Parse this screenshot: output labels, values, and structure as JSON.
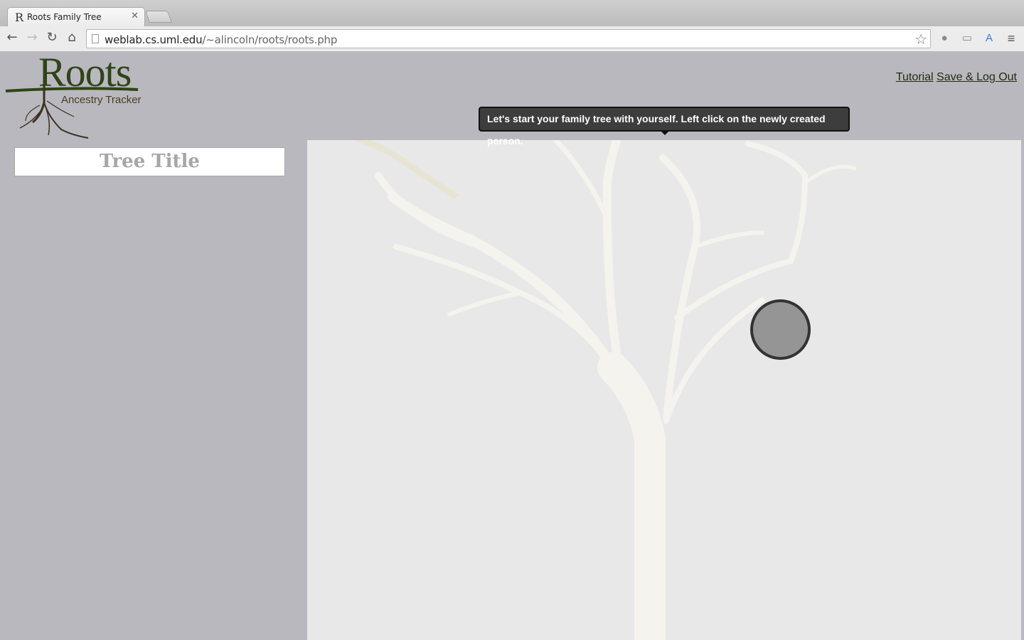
{
  "browser": {
    "tab_title": "Roots Family Tree",
    "tab_favicon": "R",
    "url_host": "weblab.cs.uml.edu",
    "url_path": "/~alincoln/roots/roots.php"
  },
  "header": {
    "logo_title": "Roots",
    "logo_subtitle": "Ancestry Tracker",
    "links": {
      "tutorial": "Tutorial",
      "save_logout": "Save & Log Out"
    }
  },
  "sidebar": {
    "tree_title": "Tree Title"
  },
  "tutorial": {
    "tooltip_text": "Let's start your family tree with yourself. Left click on the newly created person."
  },
  "colors": {
    "page_bg": "#b9b8be",
    "canvas_bg": "#e8e8e8",
    "logo_green": "#2f4418",
    "node_fill": "#959595"
  },
  "icons": {
    "back": "back-arrow-icon",
    "forward": "forward-arrow-icon",
    "reload": "reload-icon",
    "home": "home-icon",
    "star": "star-icon",
    "menu": "menu-icon"
  }
}
